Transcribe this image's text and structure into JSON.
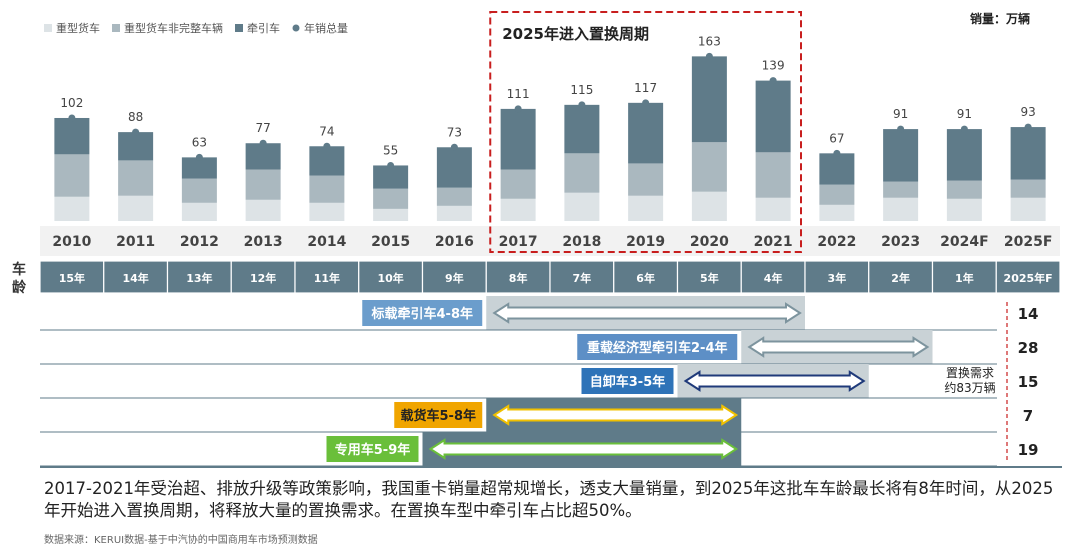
{
  "chart_data": {
    "type": "bar",
    "stacked": true,
    "categories": [
      "2010",
      "2011",
      "2012",
      "2013",
      "2014",
      "2015",
      "2016",
      "2017",
      "2018",
      "2019",
      "2020",
      "2021",
      "2022",
      "2023",
      "2024F",
      "2025F"
    ],
    "totals": [
      102,
      88,
      63,
      77,
      74,
      55,
      73,
      111,
      115,
      117,
      163,
      139,
      67,
      91,
      91,
      93
    ],
    "series": [
      {
        "name": "重型货车",
        "color": "#dde3e6",
        "values": [
          24,
          25,
          18,
          21,
          18,
          12,
          15,
          22,
          28,
          25,
          29,
          23,
          16,
          23,
          22,
          23
        ]
      },
      {
        "name": "重型货车非完整车辆",
        "color": "#aab8bf",
        "values": [
          42,
          35,
          24,
          30,
          27,
          20,
          18,
          29,
          39,
          32,
          49,
          45,
          20,
          16,
          18,
          18
        ]
      },
      {
        "name": "牵引车",
        "color": "#5f7b89",
        "values": [
          36,
          28,
          21,
          26,
          29,
          23,
          40,
          60,
          48,
          60,
          85,
          71,
          31,
          52,
          51,
          52
        ]
      }
    ],
    "legend_total": "年销总量",
    "unit_label": "销量：万辆",
    "highlight_label": "2025年进入置换周期",
    "highlight_range": [
      "2017",
      "2021"
    ],
    "age_axis": {
      "title": "车龄",
      "labels": [
        "15年",
        "14年",
        "13年",
        "12年",
        "11年",
        "10年",
        "9年",
        "8年",
        "7年",
        "6年",
        "5年",
        "4年",
        "3年",
        "2年",
        "1年",
        "2025年F"
      ]
    },
    "age_ranges": [
      {
        "label": "标载牵引车4-8年",
        "box_color": "#6b9dcc",
        "arrow_stroke": "#7d949e",
        "value": "14",
        "from": "8年",
        "to": "4年",
        "shade_from": "8年",
        "shade_to": "4年"
      },
      {
        "label": "重载经济型牵引车2-4年",
        "box_color": "#5d8fc6",
        "arrow_stroke": "#7d949e",
        "value": "28",
        "from": "4年",
        "to": "2年",
        "shade_from": "4年",
        "shade_to": "2年"
      },
      {
        "label": "自卸车3-5年",
        "box_color": "#2e73b8",
        "arrow_stroke": "#1f3a7a",
        "value": "15",
        "from": "5年",
        "to": "3年",
        "shade_from": "5年",
        "shade_to": "3年"
      },
      {
        "label": "载货车5-8年",
        "box_color": "#f0a500",
        "arrow_stroke": "#f0c000",
        "value": "7",
        "from": "8年",
        "to": "5年",
        "shade_from": "8年",
        "shade_to": "5年"
      },
      {
        "label": "专用车5-9年",
        "box_color": "#6abf3a",
        "arrow_stroke": "#6abf3a",
        "value": "19",
        "from": "9年",
        "to": "5年",
        "shade_from": "9年",
        "shade_to": "5年"
      }
    ],
    "replacement_note": [
      "置换需求",
      "约83万辆"
    ],
    "ylim": [
      0,
      170
    ]
  },
  "footnote": "2017-2021年受治超、排放升级等政策影响，我国重卡销量超常规增长，透支大量销量，到2025年这批车车龄最长将有8年时间，从2025年开始进入置换周期，将释放大量的置换需求。在置换车型中牵引车占比超50%。",
  "source": "数据来源：KERUI数据-基于中汽协的中国商用车市场预测数据"
}
